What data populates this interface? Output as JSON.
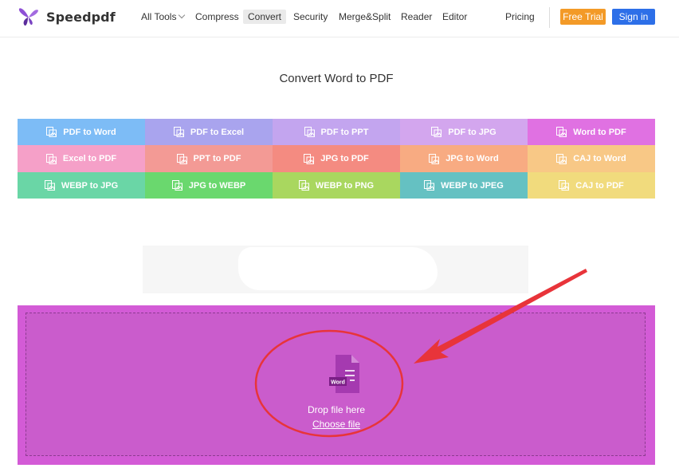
{
  "brand": {
    "name": "Speedpdf",
    "logo_icon": "butterfly-logo-icon",
    "logo_color": "#7b3fc4"
  },
  "nav": {
    "items": [
      {
        "label": "All Tools",
        "has_caret": true
      },
      {
        "label": "Compress"
      },
      {
        "label": "Convert",
        "active": true
      },
      {
        "label": "Security"
      },
      {
        "label": "Merge&Split"
      },
      {
        "label": "Reader"
      },
      {
        "label": "Editor"
      }
    ],
    "pricing": "Pricing",
    "free_trial": "Free Trial",
    "sign_in": "Sign in"
  },
  "colors": {
    "free_trial": "#f39a27",
    "sign_in": "#2d6fe8",
    "drop_zone": "#d35bd6",
    "annotation": "#e8343a"
  },
  "page_title": "Convert Word to PDF",
  "tools": [
    {
      "label": "PDF to Word",
      "color": "#7dbcf6",
      "icon": "document-image-icon"
    },
    {
      "label": "PDF to Excel",
      "color": "#a9a4ee",
      "icon": "document-image-icon"
    },
    {
      "label": "PDF to PPT",
      "color": "#c3a5ef",
      "icon": "document-image-icon"
    },
    {
      "label": "PDF to JPG",
      "color": "#d3a6ee",
      "icon": "document-image-icon"
    },
    {
      "label": "Word to PDF",
      "color": "#e071e2",
      "icon": "document-image-icon"
    },
    {
      "label": "Excel to PDF",
      "color": "#f5a0c8",
      "icon": "document-image-icon"
    },
    {
      "label": "PPT to PDF",
      "color": "#f39a95",
      "icon": "document-image-icon"
    },
    {
      "label": "JPG to PDF",
      "color": "#f48b81",
      "icon": "document-image-icon"
    },
    {
      "label": "JPG to Word",
      "color": "#f8ab82",
      "icon": "document-image-icon"
    },
    {
      "label": "CAJ to Word",
      "color": "#f8c886",
      "icon": "document-image-icon"
    },
    {
      "label": "WEBP to JPG",
      "color": "#6ad6a6",
      "icon": "document-image-icon"
    },
    {
      "label": "JPG to WEBP",
      "color": "#6ad86e",
      "icon": "document-image-icon"
    },
    {
      "label": "WEBP to PNG",
      "color": "#a9d75f",
      "icon": "document-image-icon"
    },
    {
      "label": "WEBP to JPEG",
      "color": "#65c1c2",
      "icon": "document-image-icon"
    },
    {
      "label": "CAJ to PDF",
      "color": "#f1db7d",
      "icon": "document-image-icon"
    }
  ],
  "drop": {
    "icon_label": "Word",
    "drop_text": "Drop file here",
    "choose_text": "Choose file"
  }
}
